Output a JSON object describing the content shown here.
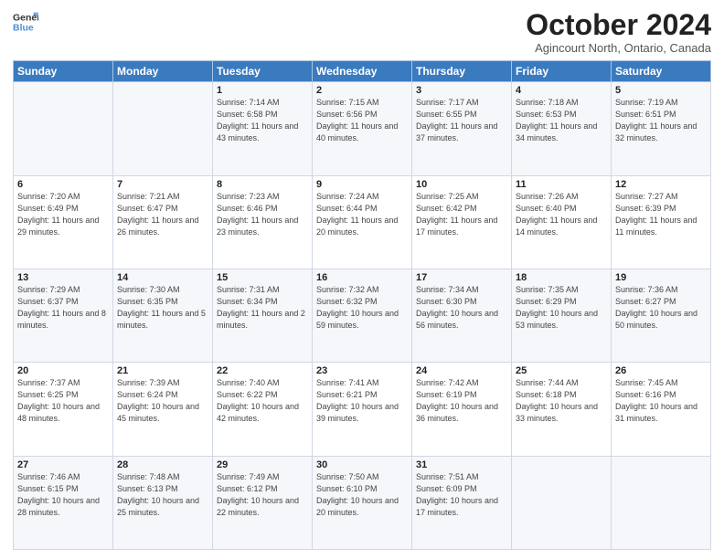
{
  "header": {
    "logo_line1": "General",
    "logo_line2": "Blue",
    "month": "October 2024",
    "location": "Agincourt North, Ontario, Canada"
  },
  "weekdays": [
    "Sunday",
    "Monday",
    "Tuesday",
    "Wednesday",
    "Thursday",
    "Friday",
    "Saturday"
  ],
  "weeks": [
    [
      {
        "day": "",
        "sunrise": "",
        "sunset": "",
        "daylight": ""
      },
      {
        "day": "",
        "sunrise": "",
        "sunset": "",
        "daylight": ""
      },
      {
        "day": "1",
        "sunrise": "Sunrise: 7:14 AM",
        "sunset": "Sunset: 6:58 PM",
        "daylight": "Daylight: 11 hours and 43 minutes."
      },
      {
        "day": "2",
        "sunrise": "Sunrise: 7:15 AM",
        "sunset": "Sunset: 6:56 PM",
        "daylight": "Daylight: 11 hours and 40 minutes."
      },
      {
        "day": "3",
        "sunrise": "Sunrise: 7:17 AM",
        "sunset": "Sunset: 6:55 PM",
        "daylight": "Daylight: 11 hours and 37 minutes."
      },
      {
        "day": "4",
        "sunrise": "Sunrise: 7:18 AM",
        "sunset": "Sunset: 6:53 PM",
        "daylight": "Daylight: 11 hours and 34 minutes."
      },
      {
        "day": "5",
        "sunrise": "Sunrise: 7:19 AM",
        "sunset": "Sunset: 6:51 PM",
        "daylight": "Daylight: 11 hours and 32 minutes."
      }
    ],
    [
      {
        "day": "6",
        "sunrise": "Sunrise: 7:20 AM",
        "sunset": "Sunset: 6:49 PM",
        "daylight": "Daylight: 11 hours and 29 minutes."
      },
      {
        "day": "7",
        "sunrise": "Sunrise: 7:21 AM",
        "sunset": "Sunset: 6:47 PM",
        "daylight": "Daylight: 11 hours and 26 minutes."
      },
      {
        "day": "8",
        "sunrise": "Sunrise: 7:23 AM",
        "sunset": "Sunset: 6:46 PM",
        "daylight": "Daylight: 11 hours and 23 minutes."
      },
      {
        "day": "9",
        "sunrise": "Sunrise: 7:24 AM",
        "sunset": "Sunset: 6:44 PM",
        "daylight": "Daylight: 11 hours and 20 minutes."
      },
      {
        "day": "10",
        "sunrise": "Sunrise: 7:25 AM",
        "sunset": "Sunset: 6:42 PM",
        "daylight": "Daylight: 11 hours and 17 minutes."
      },
      {
        "day": "11",
        "sunrise": "Sunrise: 7:26 AM",
        "sunset": "Sunset: 6:40 PM",
        "daylight": "Daylight: 11 hours and 14 minutes."
      },
      {
        "day": "12",
        "sunrise": "Sunrise: 7:27 AM",
        "sunset": "Sunset: 6:39 PM",
        "daylight": "Daylight: 11 hours and 11 minutes."
      }
    ],
    [
      {
        "day": "13",
        "sunrise": "Sunrise: 7:29 AM",
        "sunset": "Sunset: 6:37 PM",
        "daylight": "Daylight: 11 hours and 8 minutes."
      },
      {
        "day": "14",
        "sunrise": "Sunrise: 7:30 AM",
        "sunset": "Sunset: 6:35 PM",
        "daylight": "Daylight: 11 hours and 5 minutes."
      },
      {
        "day": "15",
        "sunrise": "Sunrise: 7:31 AM",
        "sunset": "Sunset: 6:34 PM",
        "daylight": "Daylight: 11 hours and 2 minutes."
      },
      {
        "day": "16",
        "sunrise": "Sunrise: 7:32 AM",
        "sunset": "Sunset: 6:32 PM",
        "daylight": "Daylight: 10 hours and 59 minutes."
      },
      {
        "day": "17",
        "sunrise": "Sunrise: 7:34 AM",
        "sunset": "Sunset: 6:30 PM",
        "daylight": "Daylight: 10 hours and 56 minutes."
      },
      {
        "day": "18",
        "sunrise": "Sunrise: 7:35 AM",
        "sunset": "Sunset: 6:29 PM",
        "daylight": "Daylight: 10 hours and 53 minutes."
      },
      {
        "day": "19",
        "sunrise": "Sunrise: 7:36 AM",
        "sunset": "Sunset: 6:27 PM",
        "daylight": "Daylight: 10 hours and 50 minutes."
      }
    ],
    [
      {
        "day": "20",
        "sunrise": "Sunrise: 7:37 AM",
        "sunset": "Sunset: 6:25 PM",
        "daylight": "Daylight: 10 hours and 48 minutes."
      },
      {
        "day": "21",
        "sunrise": "Sunrise: 7:39 AM",
        "sunset": "Sunset: 6:24 PM",
        "daylight": "Daylight: 10 hours and 45 minutes."
      },
      {
        "day": "22",
        "sunrise": "Sunrise: 7:40 AM",
        "sunset": "Sunset: 6:22 PM",
        "daylight": "Daylight: 10 hours and 42 minutes."
      },
      {
        "day": "23",
        "sunrise": "Sunrise: 7:41 AM",
        "sunset": "Sunset: 6:21 PM",
        "daylight": "Daylight: 10 hours and 39 minutes."
      },
      {
        "day": "24",
        "sunrise": "Sunrise: 7:42 AM",
        "sunset": "Sunset: 6:19 PM",
        "daylight": "Daylight: 10 hours and 36 minutes."
      },
      {
        "day": "25",
        "sunrise": "Sunrise: 7:44 AM",
        "sunset": "Sunset: 6:18 PM",
        "daylight": "Daylight: 10 hours and 33 minutes."
      },
      {
        "day": "26",
        "sunrise": "Sunrise: 7:45 AM",
        "sunset": "Sunset: 6:16 PM",
        "daylight": "Daylight: 10 hours and 31 minutes."
      }
    ],
    [
      {
        "day": "27",
        "sunrise": "Sunrise: 7:46 AM",
        "sunset": "Sunset: 6:15 PM",
        "daylight": "Daylight: 10 hours and 28 minutes."
      },
      {
        "day": "28",
        "sunrise": "Sunrise: 7:48 AM",
        "sunset": "Sunset: 6:13 PM",
        "daylight": "Daylight: 10 hours and 25 minutes."
      },
      {
        "day": "29",
        "sunrise": "Sunrise: 7:49 AM",
        "sunset": "Sunset: 6:12 PM",
        "daylight": "Daylight: 10 hours and 22 minutes."
      },
      {
        "day": "30",
        "sunrise": "Sunrise: 7:50 AM",
        "sunset": "Sunset: 6:10 PM",
        "daylight": "Daylight: 10 hours and 20 minutes."
      },
      {
        "day": "31",
        "sunrise": "Sunrise: 7:51 AM",
        "sunset": "Sunset: 6:09 PM",
        "daylight": "Daylight: 10 hours and 17 minutes."
      },
      {
        "day": "",
        "sunrise": "",
        "sunset": "",
        "daylight": ""
      },
      {
        "day": "",
        "sunrise": "",
        "sunset": "",
        "daylight": ""
      }
    ]
  ]
}
